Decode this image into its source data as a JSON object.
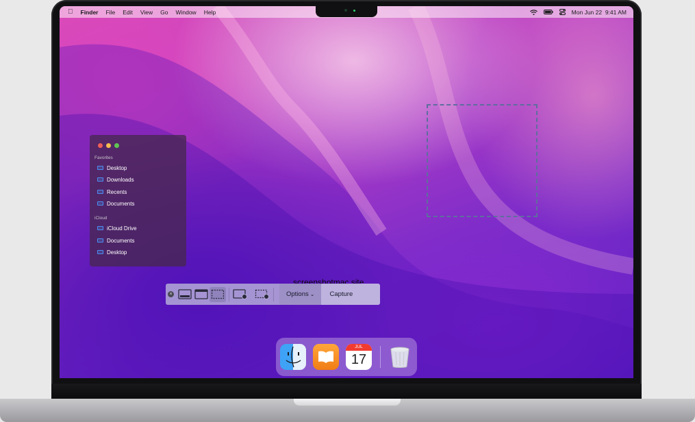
{
  "menubar": {
    "apple_icon": "apple-icon",
    "app_name": "Finder",
    "menus": [
      "File",
      "Edit",
      "View",
      "Go",
      "Window",
      "Help"
    ],
    "datetime": "Mon Jun 22  9:41 AM"
  },
  "sidebar": {
    "favorites_title": "Favorites",
    "favorites": [
      "Desktop",
      "Downloads",
      "Recents",
      "Documents"
    ],
    "icloud_title": "iCloud",
    "icloud": [
      "iCloud Drive",
      "Documents",
      "Desktop"
    ]
  },
  "watermark": "screenshotmac.site",
  "toolbar": {
    "options_label": "Options",
    "capture_label": "Capture"
  },
  "dock": {
    "calendar_month": "JUL",
    "calendar_day": "17"
  },
  "colors": {
    "traffic_red": "#ee5f57",
    "traffic_yellow": "#f5bd4f",
    "traffic_green": "#5fc453",
    "folder_blue": "#4b8ef1"
  }
}
